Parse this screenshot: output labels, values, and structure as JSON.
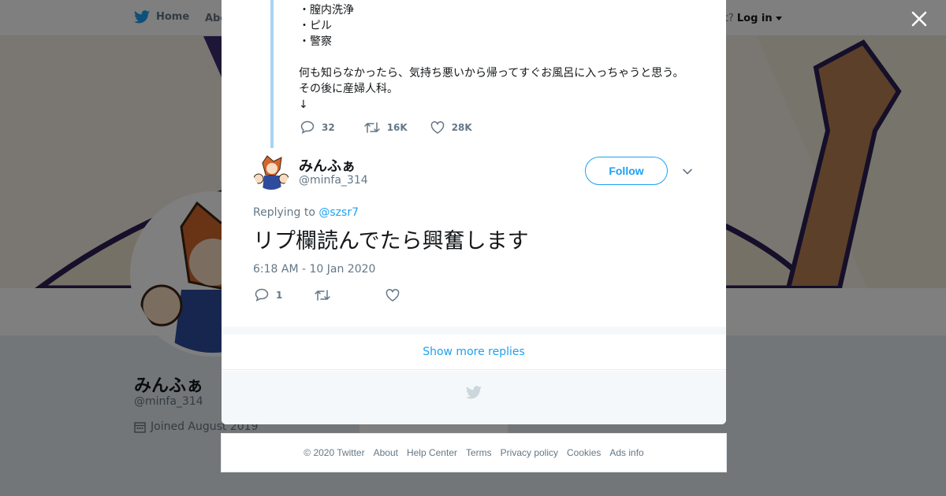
{
  "topbar": {
    "home_label": "Home",
    "about_label": "Abo",
    "account_prompt": "ccount?",
    "login_label": "Log in"
  },
  "background_profile": {
    "name": "みんふぁ",
    "handle": "@minfa_314",
    "joined": "Joined August 2019",
    "ads_info": "Ads info"
  },
  "previous_tweet": {
    "lines": [
      "・膣内洗浄",
      "・ピル",
      "・警察",
      "",
      "何も知らなかったら、気持ち悪いから帰ってすぐお風呂に入っちゃうと思う。",
      "その後に産婦人科。",
      "↓"
    ],
    "reply_count": "32",
    "retweet_count": "16K",
    "like_count": "28K"
  },
  "tweet": {
    "author_name": "みんふぁ",
    "author_handle": "@minfa_314",
    "follow_label": "Follow",
    "replying_prefix": "Replying to",
    "replying_to": "@szsr7",
    "text": "リプ欄読んでたら興奮します",
    "timestamp": "6:18 AM - 10 Jan 2020",
    "reply_count": "1",
    "retweet_count": "",
    "like_count": ""
  },
  "show_more_label": "Show more replies",
  "footer": {
    "copyright": "© 2020 Twitter",
    "links": [
      "About",
      "Help Center",
      "Terms",
      "Privacy policy",
      "Cookies",
      "Ads info"
    ]
  },
  "colors": {
    "brand_blue": "#1da1f2",
    "text_primary": "#14171a",
    "text_secondary": "#657786",
    "thread_line": "#a6d4f2"
  },
  "icons": [
    "twitter-bird-icon",
    "close-icon",
    "reply-icon",
    "retweet-icon",
    "like-icon",
    "chevron-down-icon",
    "calendar-icon"
  ]
}
